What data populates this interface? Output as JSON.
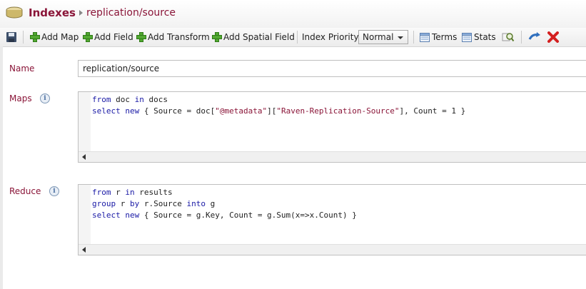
{
  "breadcrumb": {
    "root": "Indexes",
    "current": "replication/source"
  },
  "toolbar": {
    "add_map": "Add Map",
    "add_field": "Add Field",
    "add_transform": "Add Transform",
    "add_spatial_field": "Add Spatial Field",
    "index_priority_label": "Index Priority",
    "index_priority_value": "Normal",
    "terms": "Terms",
    "stats": "Stats"
  },
  "form": {
    "name_label": "Name",
    "name_value": "replication/source",
    "maps_label": "Maps",
    "reduce_label": "Reduce"
  },
  "maps_code": [
    "from doc in docs",
    "select new { Source = doc[\"@metadata\"][\"Raven-Replication-Source\"], Count = 1 }"
  ],
  "reduce_code": [
    "from r in results",
    "group r by r.Source into g",
    "select new { Source = g.Key, Count = g.Sum(x=>x.Count) }"
  ],
  "colors": {
    "accent": "#8a1538",
    "add_green": "#52a832",
    "delete_red": "#d42020"
  }
}
